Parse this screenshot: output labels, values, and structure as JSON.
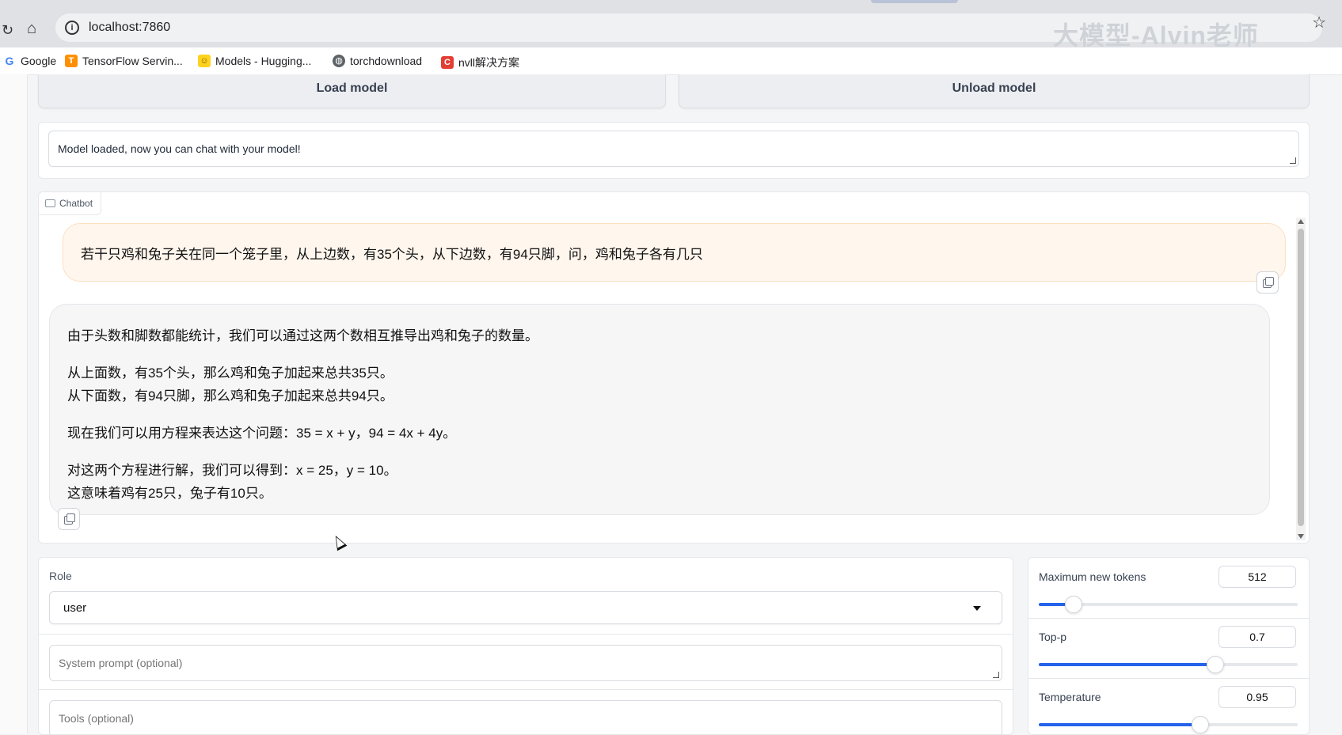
{
  "browser": {
    "url": "localhost:7860",
    "watermark": "大模型-Alvin老师",
    "bookmarks": [
      {
        "label": "Google",
        "icon": "google-icon",
        "color": "#4285f4"
      },
      {
        "label": "TensorFlow Servin...",
        "icon": "tensorflow-icon",
        "color": "#ff8f00"
      },
      {
        "label": "Models - Hugging...",
        "icon": "huggingface-icon",
        "color": "#ffd21e"
      },
      {
        "label": "torchdownload",
        "icon": "globe-icon",
        "color": "#5f6368"
      },
      {
        "label": "nvll解决方案",
        "icon": "csdn-icon",
        "color": "#e33e33"
      }
    ]
  },
  "controls": {
    "load_label": "Load model",
    "unload_label": "Unload model"
  },
  "status": {
    "message": "Model loaded, now you can chat with your model!"
  },
  "chatbot": {
    "label": "Chatbot",
    "user_message": "若干只鸡和兔子关在同一个笼子里，从上边数，有35个头，从下边数，有94只脚，问，鸡和兔子各有几只",
    "bot_lines": [
      "由于头数和脚数都能统计，我们可以通过这两个数相互推导出鸡和兔子的数量。",
      "从上面数，有35个头，那么鸡和兔子加起来总共35只。",
      "从下面数，有94只脚，那么鸡和兔子加起来总共94只。",
      "现在我们可以用方程来表达这个问题：35 = x + y，94 = 4x + 4y。",
      "对这两个方程进行解，我们可以得到：x = 25，y = 10。",
      "这意味着鸡有25只，兔子有10只。"
    ]
  },
  "inputs": {
    "role_label": "Role",
    "role_value": "user",
    "system_prompt_placeholder": "System prompt (optional)",
    "tools_placeholder": "Tools (optional)"
  },
  "params": {
    "max_tokens": {
      "label": "Maximum new tokens",
      "value": "512",
      "fraction": 0.13
    },
    "top_p": {
      "label": "Top-p",
      "value": "0.7",
      "fraction": 0.68
    },
    "temperature": {
      "label": "Temperature",
      "value": "0.95",
      "fraction": 0.62
    }
  },
  "colors": {
    "accent": "#2563eb",
    "user_bubble": "#fff6ed",
    "bot_bubble": "#f6f6f7"
  }
}
